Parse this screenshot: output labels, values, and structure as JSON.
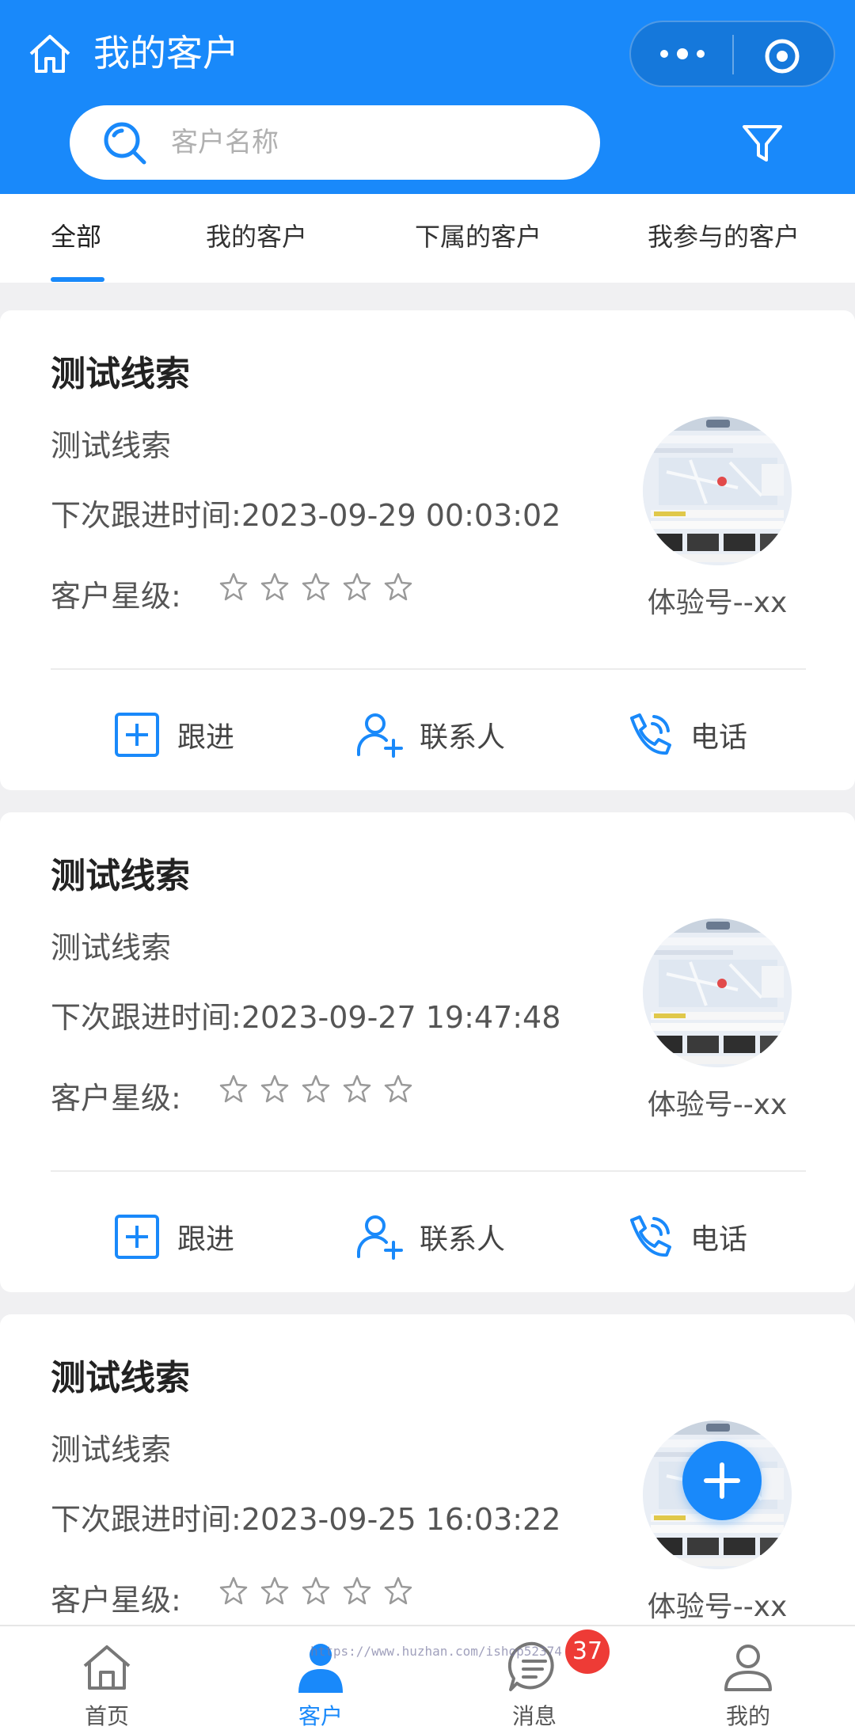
{
  "header": {
    "title": "我的客户",
    "search_placeholder": "客户名称",
    "accent_color": "#1989fa"
  },
  "tabs": [
    {
      "label": "全部",
      "active": true
    },
    {
      "label": "我的客户",
      "active": false
    },
    {
      "label": "下属的客户",
      "active": false
    },
    {
      "label": "我参与的客户",
      "active": false
    }
  ],
  "customers": [
    {
      "name": "测试线索",
      "subtitle": "测试线索",
      "next_follow_label": "下次跟进时间:",
      "next_follow_time": "2023-09-29 00:03:02",
      "rating_label": "客户星级:",
      "rating": 0,
      "rating_max": 5,
      "owner": "体验号--xx"
    },
    {
      "name": "测试线索",
      "subtitle": "测试线索",
      "next_follow_label": "下次跟进时间:",
      "next_follow_time": "2023-09-27 19:47:48",
      "rating_label": "客户星级:",
      "rating": 0,
      "rating_max": 5,
      "owner": "体验号--xx"
    },
    {
      "name": "测试线索",
      "subtitle": "测试线索",
      "next_follow_label": "下次跟进时间:",
      "next_follow_time": "2023-09-25 16:03:22",
      "rating_label": "客户星级:",
      "rating": 0,
      "rating_max": 5,
      "owner": "体验号--xx"
    }
  ],
  "actions": {
    "follow_up": "跟进",
    "contact": "联系人",
    "phone": "电话"
  },
  "bottom_nav": [
    {
      "label": "首页",
      "icon": "home-icon",
      "active": false
    },
    {
      "label": "客户",
      "icon": "user-filled-icon",
      "active": true
    },
    {
      "label": "消息",
      "icon": "message-icon",
      "active": false,
      "badge": "37"
    },
    {
      "label": "我的",
      "icon": "user-outline-icon",
      "active": false
    }
  ],
  "watermark": "https://www.huzhan.com/ishop52374"
}
